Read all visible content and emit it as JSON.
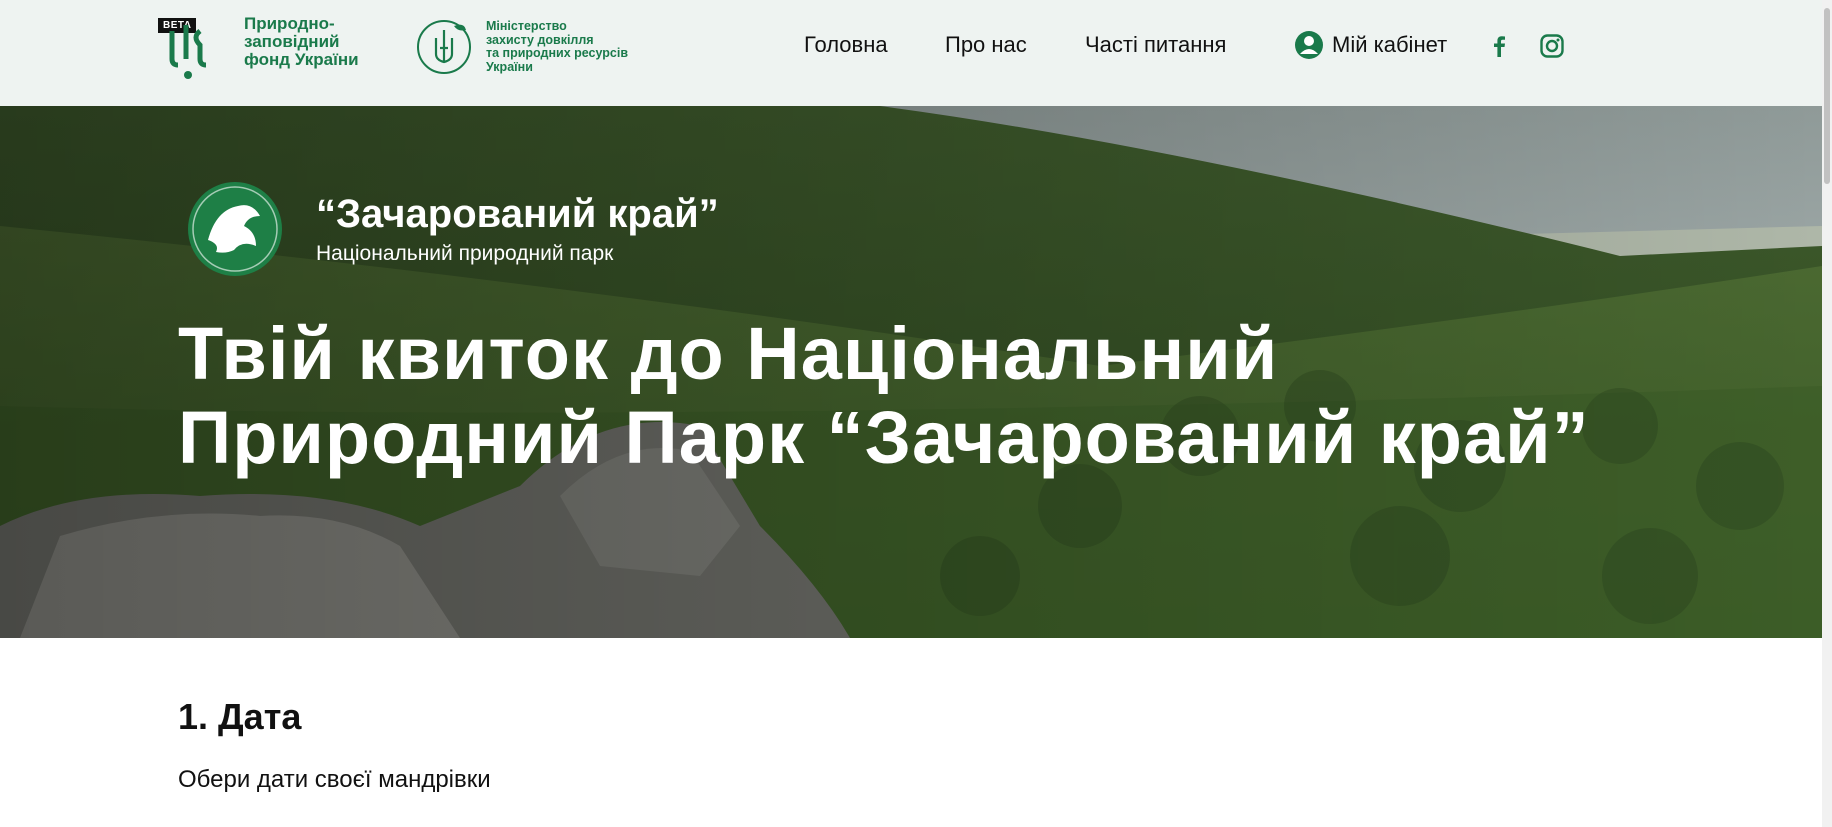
{
  "header": {
    "beta_badge": "BETA",
    "brand_lines": [
      "Природно-",
      "заповідний",
      "фонд України"
    ],
    "ministry_lines": [
      "Міністерство",
      "захисту довкілля",
      "та природних ресурсів",
      "України"
    ],
    "nav": [
      {
        "label": "Головна"
      },
      {
        "label": "Про нас"
      },
      {
        "label": "Часті питання"
      }
    ],
    "cabinet_label": "Мій кабінет",
    "social": [
      "facebook-icon",
      "instagram-icon"
    ],
    "brand_color": "#1a7a4b",
    "background": "#eef3f1"
  },
  "hero": {
    "park_name": "“Зачарований край”",
    "park_type": "Національний природний парк",
    "title": "Твій квиток до Національний Природний Парк “Зачарований край”"
  },
  "section": {
    "title": "1. Дата",
    "subtitle": "Обери дати своєї мандрівки"
  }
}
